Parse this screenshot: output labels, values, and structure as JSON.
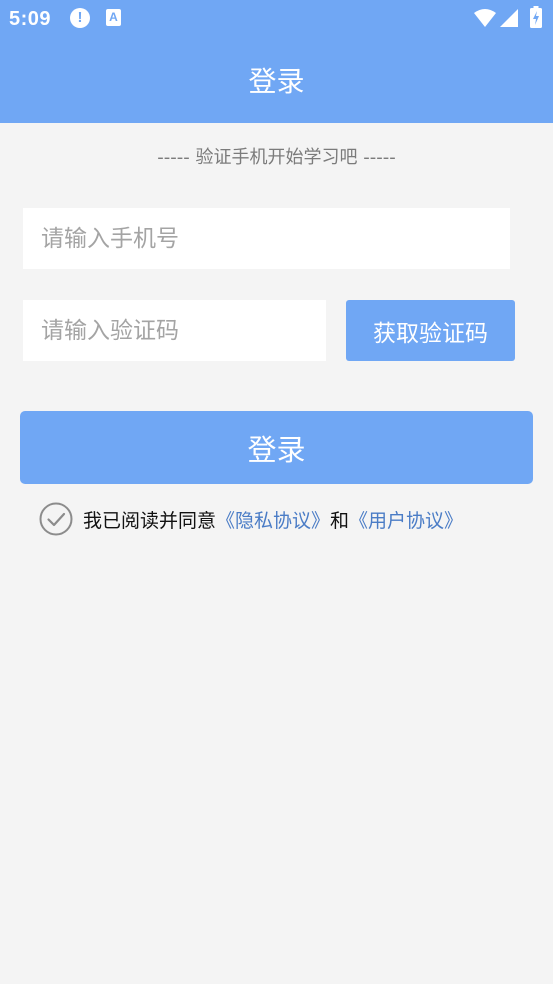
{
  "status_bar": {
    "time": "5:09",
    "icons": [
      "alert-icon",
      "accessibility-icon",
      "wifi-icon",
      "signal-icon",
      "battery-icon"
    ],
    "alert_glyph": "!",
    "a11y_glyph": "A"
  },
  "header": {
    "title": "登录",
    "background": "#70a7f4"
  },
  "hint_text": "----- 验证手机开始学习吧 -----",
  "form": {
    "phone_placeholder": "请输入手机号",
    "phone_value": "",
    "code_placeholder": "请输入验证码",
    "code_value": "",
    "get_code_label": "获取验证码",
    "login_label": "登录"
  },
  "agreement": {
    "checked": false,
    "prefix": "我已阅读并同意",
    "privacy_link": "《隐私协议》",
    "conjunction": "和",
    "user_link": "《用户协议》",
    "link_color": "#4a7cc6"
  }
}
